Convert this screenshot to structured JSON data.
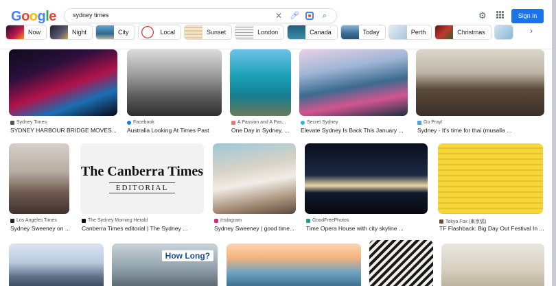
{
  "logo": "Google",
  "search": {
    "query": "sydney times"
  },
  "header": {
    "signin_label": "Sign in"
  },
  "chips": [
    {
      "label": "Now",
      "thumb": "#8a1a2c"
    },
    {
      "label": "Night",
      "thumb": "#3a3a48"
    },
    {
      "label": "City",
      "thumb": "#4c87b9"
    },
    {
      "label": "Local",
      "thumb": "#ffffff"
    },
    {
      "label": "Sunset",
      "thumb": "#e9d9b9"
    },
    {
      "label": "London",
      "thumb": "#efefef"
    },
    {
      "label": "Canada",
      "thumb": "#2c6b84"
    },
    {
      "label": "Today",
      "thumb": "#5d8fb5"
    },
    {
      "label": "Perth",
      "thumb": "#d9e6f0"
    },
    {
      "label": "Christmas",
      "thumb": "#9b2a2a"
    },
    {
      "label": "",
      "thumb": "#b9d6ea"
    }
  ],
  "results": [
    {
      "source": "Sydney Times",
      "title": "SYDNEY HARBOUR BRIDGE MOVES...",
      "fav": "#555"
    },
    {
      "source": "Facebook",
      "title": "Australia Looking At Times Past",
      "fav": "#1877f2"
    },
    {
      "source": "A Passion and A Pas...",
      "title": "One Day in Sydney, ...",
      "fav": "#e07b7b"
    },
    {
      "source": "Secret Sydney",
      "title": "Elevate Sydney Is Back This January ...",
      "fav": "#2bb3d9"
    },
    {
      "source": "Go Pray!",
      "title": "Sydney - It's time for thai (musalla ...",
      "fav": "#4aa3df"
    },
    {
      "source": "Los Angeles Times",
      "title": "Sydney Sweeney on ...",
      "fav": "#222"
    },
    {
      "source": "The Sydney Morning Herald",
      "title": "Canberra Times editorial | The Sydney ...",
      "fav": "#111"
    },
    {
      "source": "Instagram",
      "title": "Sydney Sweeney | good time...",
      "fav": "#d62976"
    },
    {
      "source": "GoodFreePhotos",
      "title": "Time Opera House with city skyline ...",
      "fav": "#2a9d8f"
    },
    {
      "source": "Tokyo Fox (東京狐)",
      "title": "TF Flashback: Big Day Out Festival In ...",
      "fav": "#6b4a2e"
    }
  ],
  "canberra": {
    "line1": "The Canberra Times",
    "line2": "EDITORIAL"
  },
  "howlong": {
    "text": "How Long?"
  }
}
